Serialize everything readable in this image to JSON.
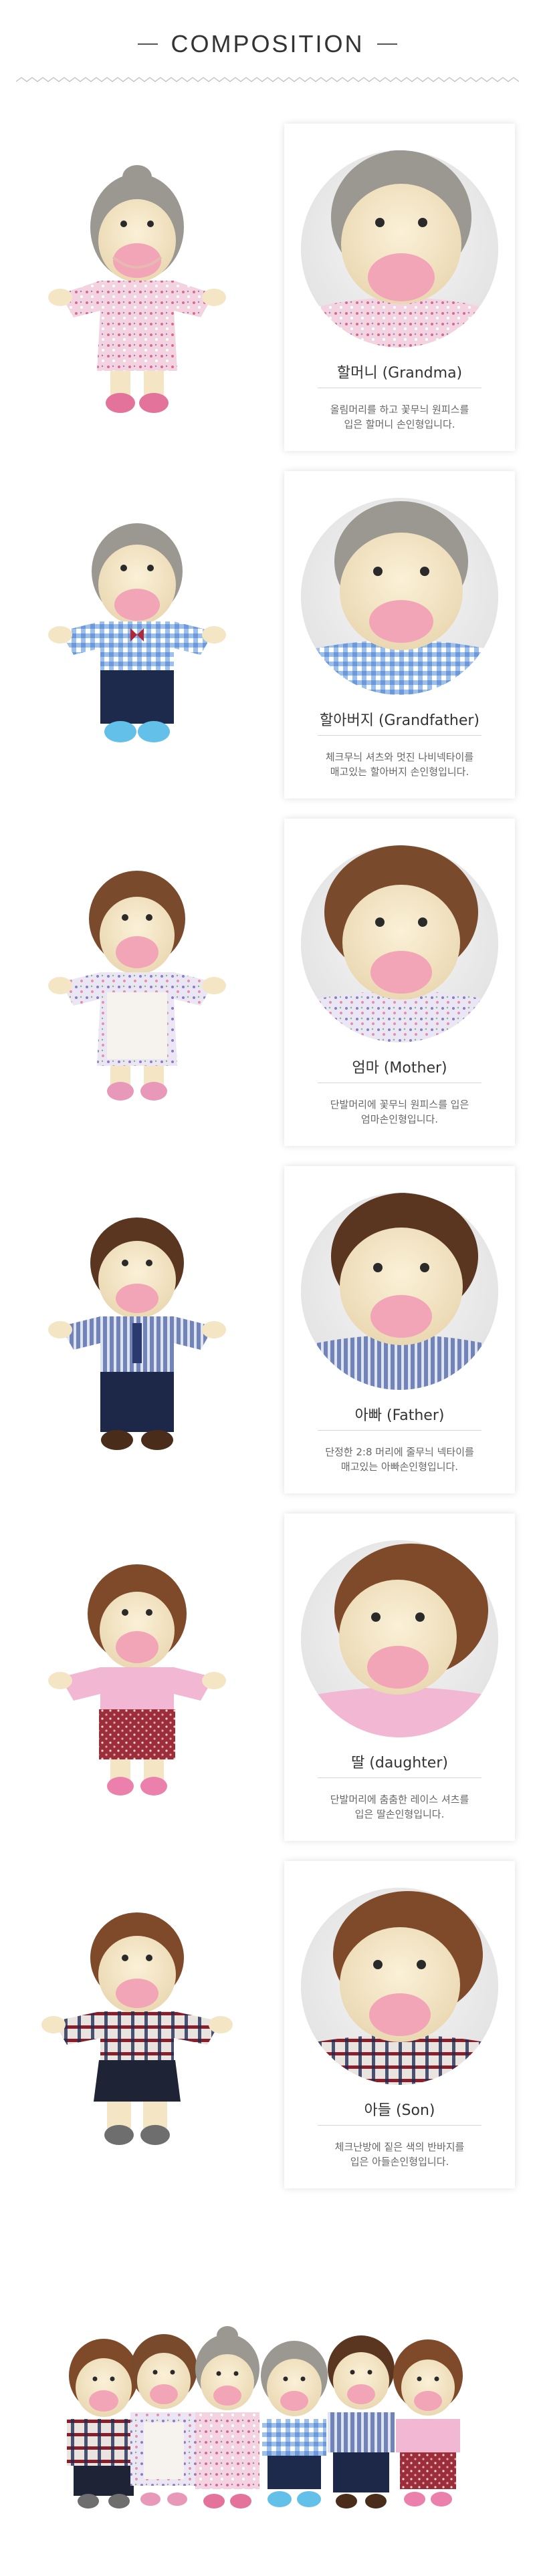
{
  "header": {
    "title": "COMPOSITION"
  },
  "items": [
    {
      "name": "할머니 (Grandma)",
      "desc_line1": "올림머리를 하고 꽃무늬 원피스를",
      "desc_line2": "입은 할머니 손인형입니다.",
      "hair": "#9b9892",
      "shirt": "#ecc6d4",
      "bottom": "#ecc6d4",
      "shoes": "#e3739a"
    },
    {
      "name": "할아버지 (Grandfather)",
      "desc_line1": "체크무늬 셔츠와 멋진 나비넥타이를",
      "desc_line2": "매고있는 할아버지 손인형입니다.",
      "hair": "#9a9890",
      "shirt": "#8fb4e6",
      "bottom": "#1e2a4c",
      "shoes": "#63c0e8"
    },
    {
      "name": "엄마 (Mother)",
      "desc_line1": "단발머리에 꽃무늬 원피스를 입은",
      "desc_line2": "엄마손인형입니다.",
      "hair": "#7a4a2c",
      "shirt": "#e6dff0",
      "bottom": "#f6f3ee",
      "shoes": "#e898b8"
    },
    {
      "name": "아빠 (Father)",
      "desc_line1": "단정한 2:8 머리에 줄무늬 넥타이를",
      "desc_line2": "매고있는 아빠손인형입니다.",
      "hair": "#5a3620",
      "shirt": "#5e6e9a",
      "bottom": "#1d2748",
      "shoes": "#4a2c1a"
    },
    {
      "name": "딸 (daughter)",
      "desc_line1": "단발머리에 춤춤한 레이스 셔츠를",
      "desc_line2": "입은 딸손인형입니다.",
      "hair": "#7e4a2a",
      "shirt": "#f1b7d3",
      "bottom": "#9c2e3a",
      "shoes": "#ec80ac"
    },
    {
      "name": "아들 (Son)",
      "desc_line1": "체크난방에 짙은 색의 반바지를",
      "desc_line2": "입은 아들손인형입니다.",
      "hair": "#7e4a2a",
      "shirt": "#6c2c34",
      "bottom": "#1e2336",
      "shoes": "#6e6e6e"
    }
  ]
}
